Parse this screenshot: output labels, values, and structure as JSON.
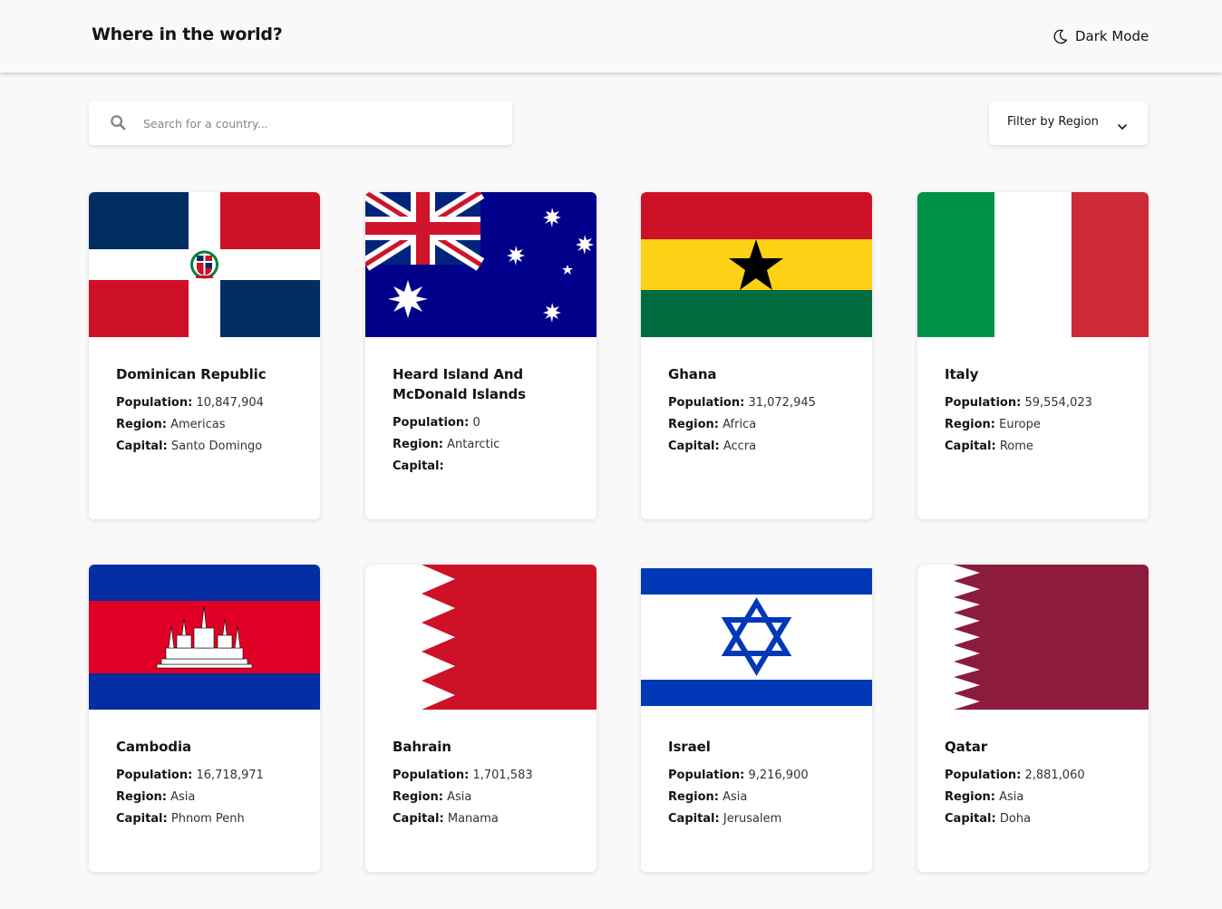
{
  "header": {
    "title": "Where in the world?",
    "theme_toggle_label": "Dark Mode"
  },
  "search": {
    "placeholder": "Search for a country...",
    "value": ""
  },
  "filter": {
    "label": "Filter by Region"
  },
  "labels": {
    "population": "Population:",
    "region": "Region:",
    "capital": "Capital:"
  },
  "countries": [
    {
      "name": "Dominican Republic",
      "population": "10,847,904",
      "region": "Americas",
      "capital": "Santo Domingo"
    },
    {
      "name": "Heard Island And McDonald Islands",
      "population": "0",
      "region": "Antarctic",
      "capital": ""
    },
    {
      "name": "Ghana",
      "population": "31,072,945",
      "region": "Africa",
      "capital": "Accra"
    },
    {
      "name": "Italy",
      "population": "59,554,023",
      "region": "Europe",
      "capital": "Rome"
    },
    {
      "name": "Cambodia",
      "population": "16,718,971",
      "region": "Asia",
      "capital": "Phnom Penh"
    },
    {
      "name": "Bahrain",
      "population": "1,701,583",
      "region": "Asia",
      "capital": "Manama"
    },
    {
      "name": "Israel",
      "population": "9,216,900",
      "region": "Asia",
      "capital": "Jerusalem"
    },
    {
      "name": "Qatar",
      "population": "2,881,060",
      "region": "Asia",
      "capital": "Doha"
    }
  ],
  "icons": {
    "theme": "moon-icon",
    "search": "search-icon",
    "filter": "chevron-down-icon"
  },
  "colors": {
    "background": "#f9f9f9",
    "card": "#ffffff",
    "text": "#111517"
  }
}
